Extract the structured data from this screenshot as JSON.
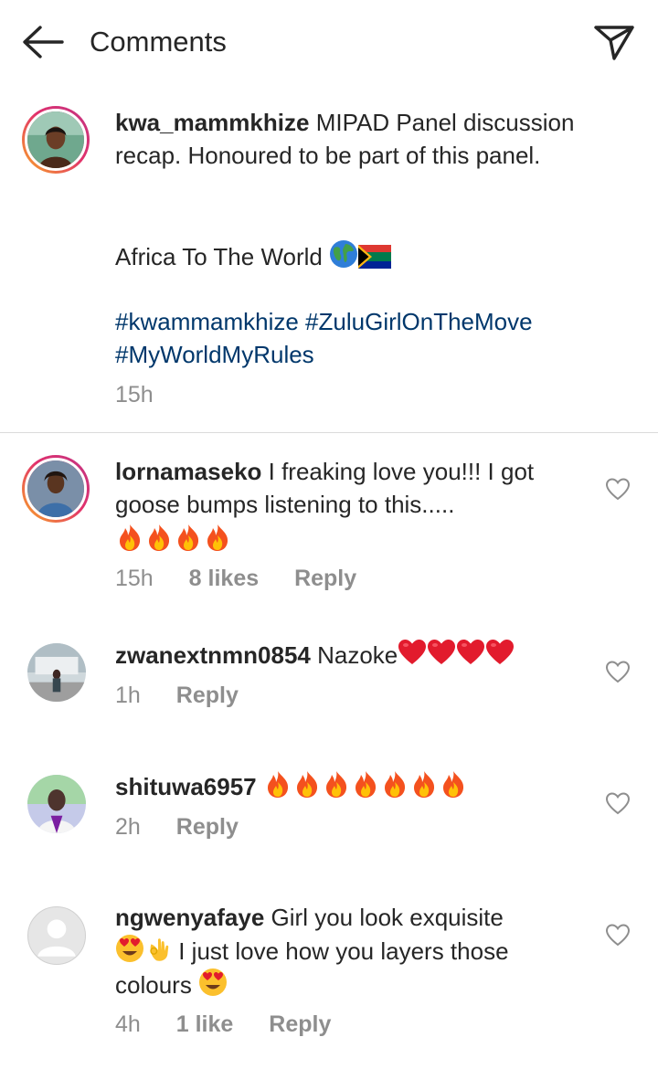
{
  "header": {
    "title": "Comments",
    "back_icon": "arrow-left-icon",
    "send_icon": "paper-plane-icon"
  },
  "caption": {
    "username": "kwa_mammkhize",
    "text_line1": "MIPAD Panel discussion recap. Honoured to be part of this panel.",
    "text_line2": "Africa To The World",
    "emojis_line2": [
      "globe-emoji",
      "south-africa-flag-emoji"
    ],
    "hashtags": "#kwammamkhize #ZuluGirlOnTheMove #MyWorldMyRules",
    "time": "15h"
  },
  "comments": [
    {
      "username": "lornamaseko",
      "text": "I freaking love you!!! I got goose bumps listening to this.....",
      "emojis": [
        "fire",
        "fire",
        "fire",
        "fire"
      ],
      "time": "15h",
      "likes": "8 likes",
      "reply": "Reply"
    },
    {
      "username": "zwanextnmn0854",
      "text": "Nazoke",
      "emojis": [
        "red-heart",
        "red-heart",
        "red-heart",
        "red-heart"
      ],
      "time": "1h",
      "reply": "Reply"
    },
    {
      "username": "shituwa6957",
      "text": "",
      "emojis": [
        "fire",
        "fire",
        "fire",
        "fire",
        "fire",
        "fire",
        "fire"
      ],
      "time": "2h",
      "reply": "Reply"
    },
    {
      "username": "ngwenyafaye",
      "text_part1": "Girl you look exquisite",
      "text_part2": "I just love how you layers those",
      "text_part3": "colours",
      "time": "4h",
      "likes": "1 like",
      "reply": "Reply"
    }
  ],
  "colors": {
    "text": "#262626",
    "secondary": "#8e8e8e",
    "hashtag": "#00376b",
    "divider": "#dbdbdb"
  }
}
